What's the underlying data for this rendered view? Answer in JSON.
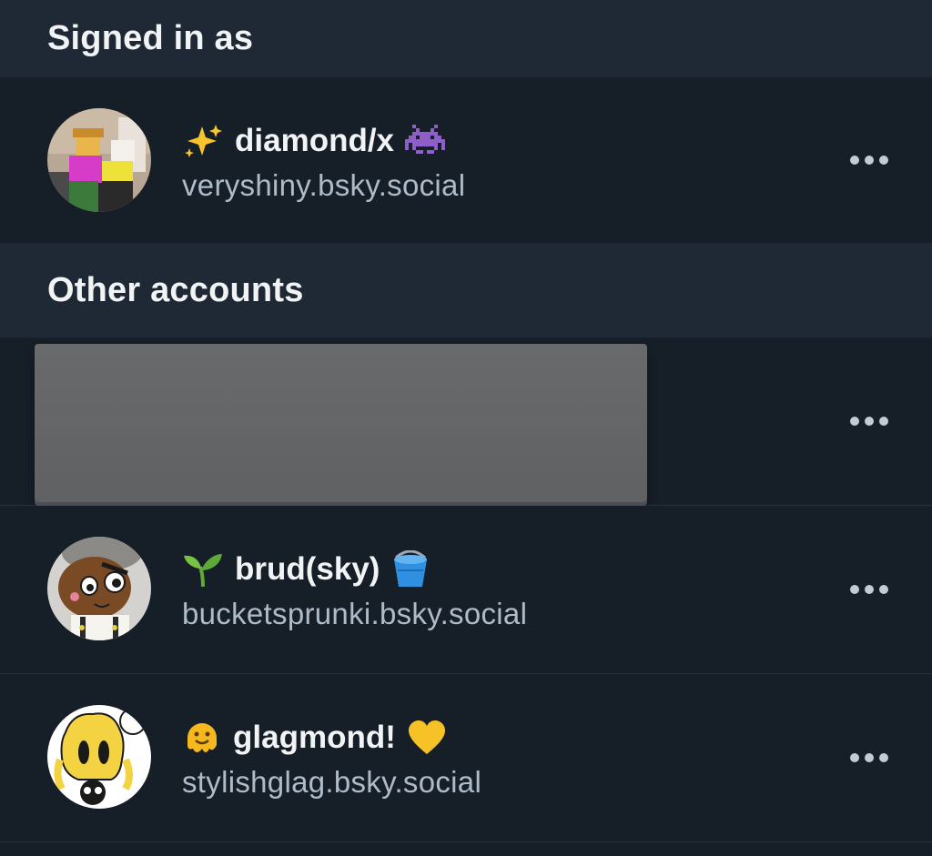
{
  "sections": {
    "signed_in_title": "Signed in as",
    "other_title": "Other accounts"
  },
  "current_account": {
    "display_name": "diamond/x",
    "handle": "veryshiny.bsky.social",
    "lead_emoji": "sparkles-icon",
    "trail_emoji": "alien-monster-icon"
  },
  "other_accounts": [
    {
      "redacted": true
    },
    {
      "display_name": "brud(sky)",
      "handle": "bucketsprunki.bsky.social",
      "lead_emoji": "seedling-icon",
      "trail_emoji": "bucket-icon"
    },
    {
      "display_name": "glagmond!",
      "handle": "stylishglag.bsky.social",
      "lead_emoji": "melting-face-icon",
      "trail_emoji": "yellow-heart-icon"
    }
  ],
  "colors": {
    "background": "#161e27",
    "section_header_bg": "#1e2935",
    "handle_text": "#aebbc9",
    "divider": "#26323f",
    "more_dots": "#c3ccd6"
  }
}
